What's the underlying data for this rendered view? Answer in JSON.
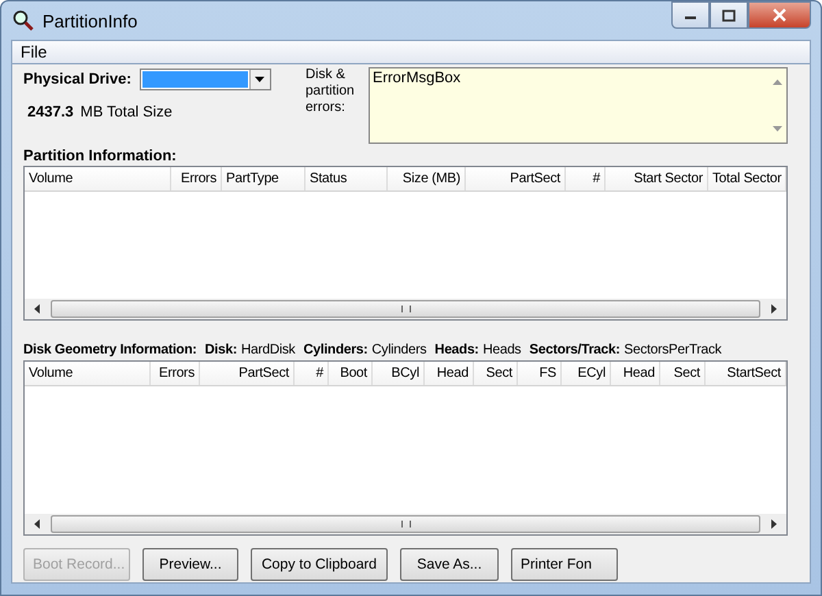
{
  "window": {
    "title": "PartitionInfo"
  },
  "menu": [
    {
      "label": "File"
    }
  ],
  "drive": {
    "label": "Physical Drive:",
    "total_value": "2437.3",
    "total_unit": "MB Total Size"
  },
  "errors": {
    "label": "Disk & partition errors:",
    "value": "ErrorMsgBox"
  },
  "partition_table": {
    "title": "Partition Information:",
    "columns": [
      "Volume",
      "Errors",
      "PartType",
      "Status",
      "Size (MB)",
      "PartSect",
      "#",
      "Start Sector",
      "Total Sector"
    ]
  },
  "geometry": {
    "title": "Disk Geometry Information:",
    "fields": [
      {
        "label": "Disk:",
        "value": "HardDisk"
      },
      {
        "label": "Cylinders:",
        "value": "Cylinders"
      },
      {
        "label": "Heads:",
        "value": "Heads"
      },
      {
        "label": "Sectors/Track:",
        "value": "SectorsPerTrack"
      }
    ]
  },
  "geometry_table": {
    "columns": [
      "Volume",
      "Errors",
      "PartSect",
      "#",
      "Boot",
      "BCyl",
      "Head",
      "Sect",
      "FS",
      "ECyl",
      "Head",
      "Sect",
      "StartSect"
    ]
  },
  "buttons": [
    {
      "label": "Boot Record...",
      "disabled": true
    },
    {
      "label": "Preview...",
      "disabled": false
    },
    {
      "label": "Copy to Clipboard",
      "disabled": false
    },
    {
      "label": "Save As...",
      "disabled": false
    },
    {
      "label": "Printer Fon",
      "disabled": false
    }
  ]
}
